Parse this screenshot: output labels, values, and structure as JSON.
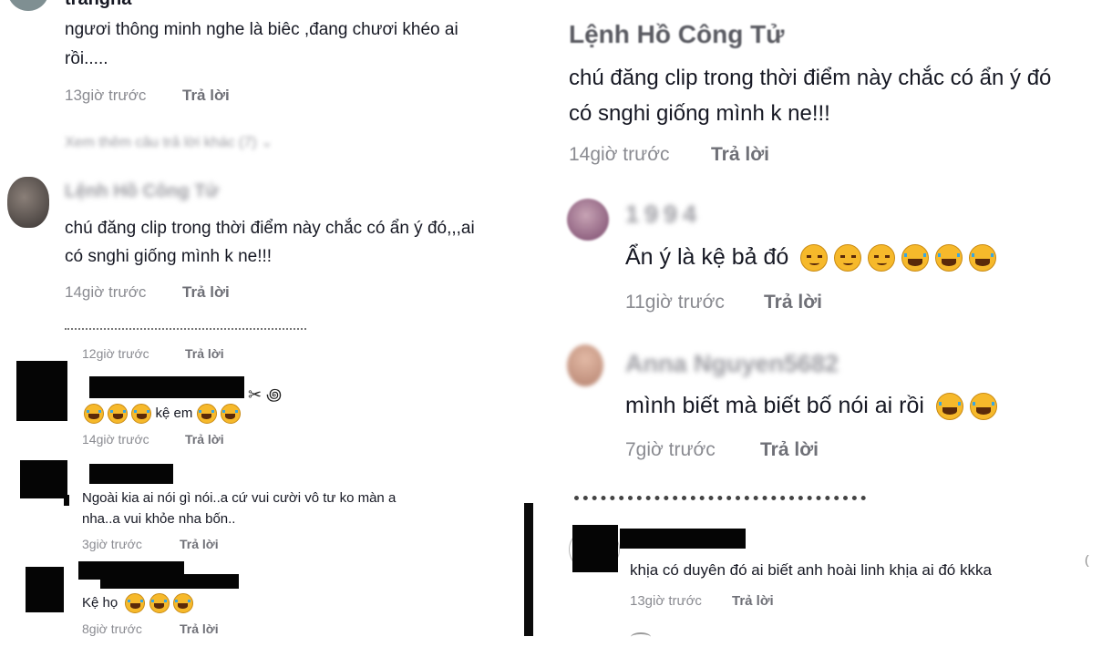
{
  "panel_top_left": {
    "c1": {
      "name": "trangha",
      "text_line1": "ngươi thông minh nghe là biêc ,đang chươi khéo ai",
      "text_line2": "rồi.....",
      "time": "13giờ trước",
      "reply": "Trả lời"
    },
    "view_more": "Xem thêm câu trả lời khác (7)",
    "c2": {
      "name": "Lệnh Hồ Công Tử",
      "text_line1": "chú đăng clip trong thời điểm này chắc có ẩn ý đó,,,ai",
      "text_line2": "có snghi giống mình k ne!!!",
      "time": "14giờ trước",
      "reply": "Trả lời"
    }
  },
  "panel_top_right": {
    "c1": {
      "name": "Lệnh Hồ Công Tử",
      "text_line1": "chú đăng clip trong thời điểm này chắc có ẩn ý đó",
      "text_line2": "có snghi giống mình k ne!!!",
      "time": "14giờ trước",
      "reply": "Trả lời"
    },
    "c2": {
      "name": "1994",
      "text": "Ẩn ý là kệ bả đó",
      "time": "11giờ trước",
      "reply": "Trả lời"
    },
    "c3": {
      "name": "Anna Nguyen5682",
      "text": "mình biết mà biết bố nói ai rồi",
      "time": "7giờ trước",
      "reply": "Trả lời"
    }
  },
  "panel_bottom_left": {
    "top_time": "12giờ trước",
    "top_reply": "Trả lời",
    "c1": {
      "text": "kệ em",
      "time": "14giờ trước",
      "reply": "Trả lời"
    },
    "c2": {
      "text_line1": "Ngoài kia ai nói gì nói..a cứ vui cười vô tư ko màn a",
      "text_line2": "nha..a vui khỏe nha bốn..",
      "time": "3giờ trước",
      "reply": "Trả lời"
    },
    "c3": {
      "text": "Kệ họ",
      "time": "8giờ trước",
      "reply": "Trả lời"
    }
  },
  "panel_bottom_right": {
    "c1": {
      "text": "khịa có duyên đó ai biết anh hoài linh khịa ai đó kkka",
      "time": "13giờ trước",
      "reply": "Trả lời"
    }
  },
  "colors": {
    "text": "#161823",
    "time": "#8a8b91",
    "reply": "#6f7077",
    "emoji": "#f6b92b",
    "redaction": "#050505"
  },
  "icons": [
    "chevron-down-icon",
    "face-with-tears-of-joy-icon",
    "pensive-face-icon",
    "avatar"
  ]
}
